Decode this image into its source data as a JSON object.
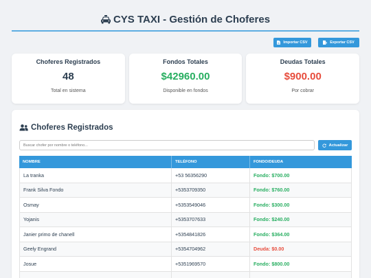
{
  "header": {
    "icon": "taxi-icon",
    "title": "CYS TAXI - Gestión de Choferes"
  },
  "actions": {
    "import_label": "Importar CSV",
    "export_label": "Exportar CSV",
    "icon": "file-icon"
  },
  "stats": [
    {
      "title": "Choferes Registrados",
      "value": "48",
      "caption": "Total en sistema",
      "color": "#2c3e50"
    },
    {
      "title": "Fondos Totales",
      "value": "$42960.00",
      "caption": "Disponible en fondos",
      "color": "#27ae60"
    },
    {
      "title": "Deudas Totales",
      "value": "$900.00",
      "caption": "Por cobrar",
      "color": "#e74c3c"
    }
  ],
  "list": {
    "icon": "users-icon",
    "heading": "Choferes Registrados",
    "search_placeholder": "Buscar chofer por nombre o teléfono...",
    "refresh_label": "Actualizar",
    "columns": [
      "NOMBRE",
      "TELÉFONO",
      "FONDO/DEUDA"
    ],
    "rows": [
      {
        "name": "La tranka",
        "phone": "+53 56356290",
        "balance": "Fondo: $700.00"
      },
      {
        "name": "Frank Silva Fondo",
        "phone": "+5353709350",
        "balance": "Fondo: $760.00"
      },
      {
        "name": "Osmay",
        "phone": "+5353549046",
        "balance": "Fondo: $300.00"
      },
      {
        "name": "Yojanis",
        "phone": "+5353707633",
        "balance": "Fondo: $240.00"
      },
      {
        "name": "Janier primo de chanell",
        "phone": "+5354841826",
        "balance": "Fondo: $364.00"
      },
      {
        "name": "Geely Engrand",
        "phone": "+5354704962",
        "balance": "Deuda: $0.00"
      },
      {
        "name": "Josue",
        "phone": "+5351969570",
        "balance": "Fondo: $800.00"
      }
    ]
  },
  "colors": {
    "accent": "#3498db",
    "fondo": "#27ae60",
    "deuda": "#e74c3c",
    "text": "#2c3e50"
  }
}
